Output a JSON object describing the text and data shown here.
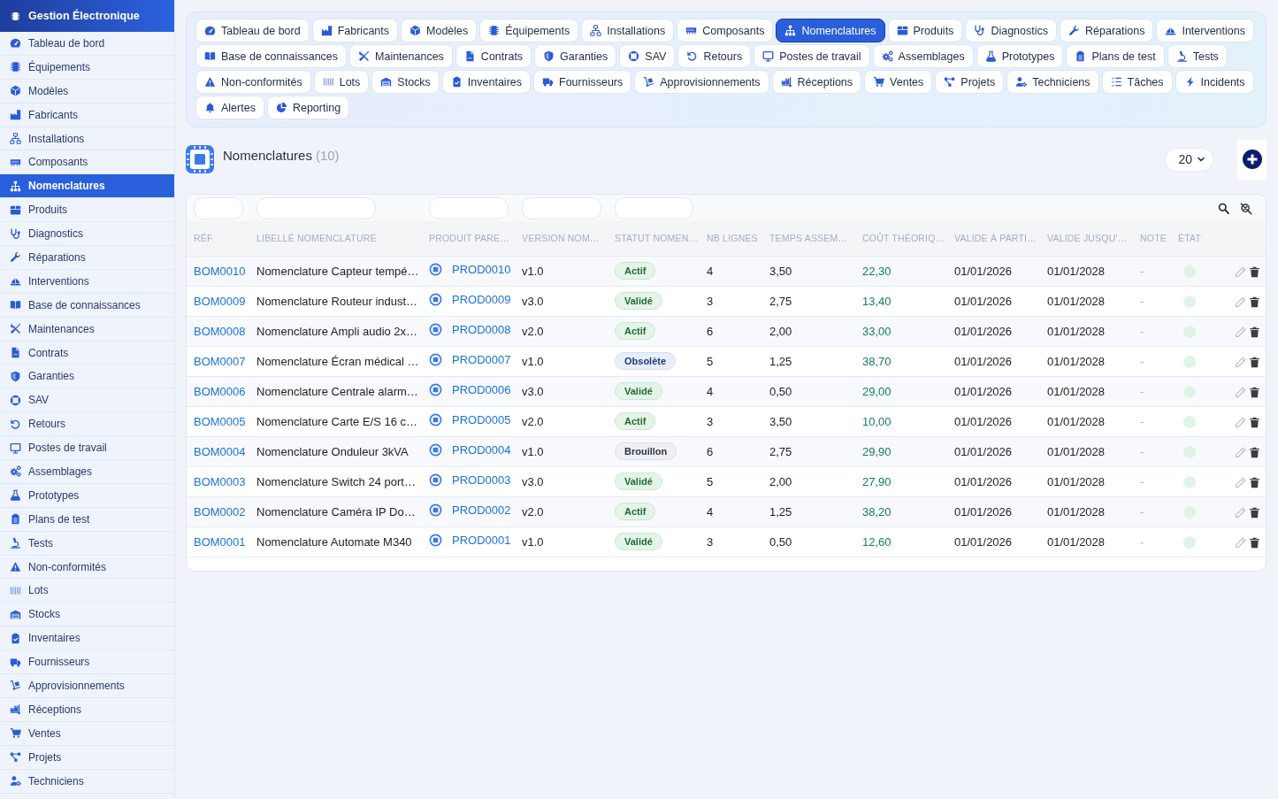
{
  "sidebar": {
    "title": "Gestion Électronique",
    "items": [
      {
        "label": "Tableau de bord",
        "selected": false
      },
      {
        "label": "Équipements",
        "selected": false
      },
      {
        "label": "Modèles",
        "selected": false
      },
      {
        "label": "Fabricants",
        "selected": false
      },
      {
        "label": "Installations",
        "selected": false
      },
      {
        "label": "Composants",
        "selected": false
      },
      {
        "label": "Nomenclatures",
        "selected": true
      },
      {
        "label": "Produits",
        "selected": false
      },
      {
        "label": "Diagnostics",
        "selected": false
      },
      {
        "label": "Réparations",
        "selected": false
      },
      {
        "label": "Interventions",
        "selected": false
      },
      {
        "label": "Base de connaissances",
        "selected": false
      },
      {
        "label": "Maintenances",
        "selected": false
      },
      {
        "label": "Contrats",
        "selected": false
      },
      {
        "label": "Garanties",
        "selected": false
      },
      {
        "label": "SAV",
        "selected": false
      },
      {
        "label": "Retours",
        "selected": false
      },
      {
        "label": "Postes de travail",
        "selected": false
      },
      {
        "label": "Assemblages",
        "selected": false
      },
      {
        "label": "Prototypes",
        "selected": false
      },
      {
        "label": "Plans de test",
        "selected": false
      },
      {
        "label": "Tests",
        "selected": false
      },
      {
        "label": "Non-conformités",
        "selected": false
      },
      {
        "label": "Lots",
        "selected": false
      },
      {
        "label": "Stocks",
        "selected": false
      },
      {
        "label": "Inventaires",
        "selected": false
      },
      {
        "label": "Fournisseurs",
        "selected": false
      },
      {
        "label": "Approvisionnements",
        "selected": false
      },
      {
        "label": "Réceptions",
        "selected": false
      },
      {
        "label": "Ventes",
        "selected": false
      },
      {
        "label": "Projets",
        "selected": false
      },
      {
        "label": "Techniciens",
        "selected": false
      }
    ]
  },
  "tabs": [
    {
      "label": "Tableau de bord",
      "selected": false
    },
    {
      "label": "Fabricants",
      "selected": false
    },
    {
      "label": "Modèles",
      "selected": false
    },
    {
      "label": "Équipements",
      "selected": false
    },
    {
      "label": "Installations",
      "selected": false
    },
    {
      "label": "Composants",
      "selected": false
    },
    {
      "label": "Nomenclatures",
      "selected": true
    },
    {
      "label": "Produits",
      "selected": false
    },
    {
      "label": "Diagnostics",
      "selected": false
    },
    {
      "label": "Réparations",
      "selected": false
    },
    {
      "label": "Interventions",
      "selected": false
    },
    {
      "label": "Base de connaissances",
      "selected": false
    },
    {
      "label": "Maintenances",
      "selected": false
    },
    {
      "label": "Contrats",
      "selected": false
    },
    {
      "label": "Garanties",
      "selected": false
    },
    {
      "label": "SAV",
      "selected": false
    },
    {
      "label": "Retours",
      "selected": false
    },
    {
      "label": "Postes de travail",
      "selected": false
    },
    {
      "label": "Assemblages",
      "selected": false
    },
    {
      "label": "Prototypes",
      "selected": false
    },
    {
      "label": "Plans de test",
      "selected": false
    },
    {
      "label": "Tests",
      "selected": false
    },
    {
      "label": "Non-conformités",
      "selected": false
    },
    {
      "label": "Lots",
      "selected": false
    },
    {
      "label": "Stocks",
      "selected": false
    },
    {
      "label": "Inventaires",
      "selected": false
    },
    {
      "label": "Fournisseurs",
      "selected": false
    },
    {
      "label": "Approvisionnements",
      "selected": false
    },
    {
      "label": "Réceptions",
      "selected": false
    },
    {
      "label": "Ventes",
      "selected": false
    },
    {
      "label": "Projets",
      "selected": false
    },
    {
      "label": "Techniciens",
      "selected": false
    },
    {
      "label": "Tâches",
      "selected": false
    },
    {
      "label": "Incidents",
      "selected": false
    },
    {
      "label": "Alertes",
      "selected": false
    },
    {
      "label": "Reporting",
      "selected": false
    }
  ],
  "page": {
    "title": "Nomenclatures",
    "count": "(10)",
    "page_size": "20"
  },
  "table": {
    "columns": [
      {
        "label": "RÉF",
        "filter": true
      },
      {
        "label": "LIBELLÉ NOMENCLATURE",
        "filter": true
      },
      {
        "label": "PRODUIT PARE…",
        "filter": true
      },
      {
        "label": "VERSION NOM…",
        "filter": true
      },
      {
        "label": "STATUT NOMEN…",
        "filter": true
      },
      {
        "label": "NB LIGNES",
        "filter": false
      },
      {
        "label": "TEMPS ASSEM…",
        "filter": false
      },
      {
        "label": "COÛT THÉORIQ…",
        "filter": false
      },
      {
        "label": "VALIDE À PARTI…",
        "filter": false
      },
      {
        "label": "VALIDE JUSQU'…",
        "filter": false
      },
      {
        "label": "NOTE",
        "filter": false
      },
      {
        "label": "ÉTAT",
        "filter": false
      }
    ],
    "rows": [
      {
        "ref": "BOM0010",
        "label": "Nomenclature Capteur tempé…",
        "product": "PROD0010",
        "version": "v1.0",
        "status": {
          "text": "Actif",
          "kind": "success"
        },
        "lines": "4",
        "time": "3,50",
        "cost": "22,30",
        "valid_from": "01/01/2026",
        "valid_to": "01/01/2028",
        "note": "-",
        "active": true
      },
      {
        "ref": "BOM0009",
        "label": "Nomenclature Routeur indust…",
        "product": "PROD0009",
        "version": "v3.0",
        "status": {
          "text": "Validé",
          "kind": "success"
        },
        "lines": "3",
        "time": "2,75",
        "cost": "13,40",
        "valid_from": "01/01/2026",
        "valid_to": "01/01/2028",
        "note": "-",
        "active": true
      },
      {
        "ref": "BOM0008",
        "label": "Nomenclature Ampli audio 2x…",
        "product": "PROD0008",
        "version": "v2.0",
        "status": {
          "text": "Actif",
          "kind": "success"
        },
        "lines": "6",
        "time": "2,00",
        "cost": "33,00",
        "valid_from": "01/01/2026",
        "valid_to": "01/01/2028",
        "note": "-",
        "active": true
      },
      {
        "ref": "BOM0007",
        "label": "Nomenclature Écran médical …",
        "product": "PROD0007",
        "version": "v1.0",
        "status": {
          "text": "Obsolète",
          "kind": "info"
        },
        "lines": "5",
        "time": "1,25",
        "cost": "38,70",
        "valid_from": "01/01/2026",
        "valid_to": "01/01/2028",
        "note": "-",
        "active": true
      },
      {
        "ref": "BOM0006",
        "label": "Nomenclature Centrale alarm…",
        "product": "PROD0006",
        "version": "v3.0",
        "status": {
          "text": "Validé",
          "kind": "success"
        },
        "lines": "4",
        "time": "0,50",
        "cost": "29,00",
        "valid_from": "01/01/2026",
        "valid_to": "01/01/2028",
        "note": "-",
        "active": true
      },
      {
        "ref": "BOM0005",
        "label": "Nomenclature Carte E/S 16 c…",
        "product": "PROD0005",
        "version": "v2.0",
        "status": {
          "text": "Actif",
          "kind": "success"
        },
        "lines": "3",
        "time": "3,50",
        "cost": "10,00",
        "valid_from": "01/01/2026",
        "valid_to": "01/01/2028",
        "note": "-",
        "active": true
      },
      {
        "ref": "BOM0004",
        "label": "Nomenclature Onduleur 3kVA",
        "product": "PROD0004",
        "version": "v1.0",
        "status": {
          "text": "Brouillon",
          "kind": "neutral"
        },
        "lines": "6",
        "time": "2,75",
        "cost": "29,90",
        "valid_from": "01/01/2026",
        "valid_to": "01/01/2028",
        "note": "-",
        "active": true
      },
      {
        "ref": "BOM0003",
        "label": "Nomenclature Switch 24 port…",
        "product": "PROD0003",
        "version": "v3.0",
        "status": {
          "text": "Validé",
          "kind": "success"
        },
        "lines": "5",
        "time": "2,00",
        "cost": "27,90",
        "valid_from": "01/01/2026",
        "valid_to": "01/01/2028",
        "note": "-",
        "active": true
      },
      {
        "ref": "BOM0002",
        "label": "Nomenclature Caméra IP Do…",
        "product": "PROD0002",
        "version": "v2.0",
        "status": {
          "text": "Actif",
          "kind": "success"
        },
        "lines": "4",
        "time": "1,25",
        "cost": "38,20",
        "valid_from": "01/01/2026",
        "valid_to": "01/01/2028",
        "note": "-",
        "active": true
      },
      {
        "ref": "BOM0001",
        "label": "Nomenclature Automate M340",
        "product": "PROD0001",
        "version": "v1.0",
        "status": {
          "text": "Validé",
          "kind": "success"
        },
        "lines": "3",
        "time": "0,50",
        "cost": "12,60",
        "valid_from": "01/01/2026",
        "valid_to": "01/01/2028",
        "note": "-",
        "active": true
      }
    ]
  }
}
